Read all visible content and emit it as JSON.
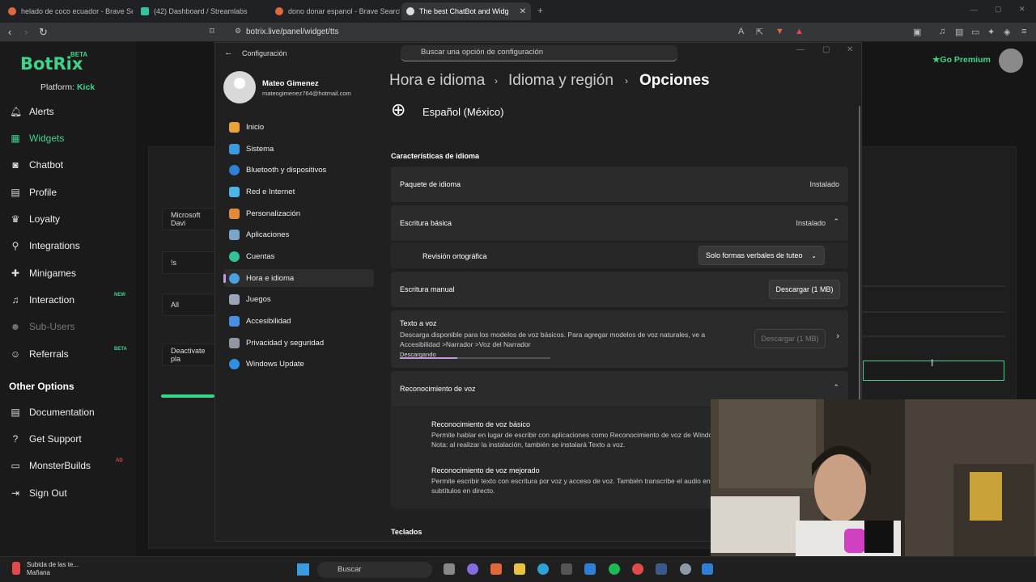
{
  "browser": {
    "tabs": [
      {
        "title": "helado de coco ecuador - Brave Search"
      },
      {
        "title": "(42) Dashboard / Streamlabs"
      },
      {
        "title": "dono donar espanol - Brave Search"
      },
      {
        "title": "The best ChatBot and Widgets fo"
      }
    ],
    "url": "botrix.live/panel/widget/tts"
  },
  "botrix": {
    "logo": "BotRix",
    "beta": "BETA",
    "platform_label": "Platform:",
    "platform_value": "Kick",
    "go_premium": "Go Premium",
    "menu": [
      {
        "label": "Alerts",
        "icon": "bell-icon"
      },
      {
        "label": "Widgets",
        "icon": "grid-icon"
      },
      {
        "label": "Chatbot",
        "icon": "robot-icon"
      },
      {
        "label": "Profile",
        "icon": "id-card-icon"
      },
      {
        "label": "Loyalty",
        "icon": "trophy-icon"
      },
      {
        "label": "Integrations",
        "icon": "plug-icon"
      },
      {
        "label": "Minigames",
        "icon": "gamepad-icon"
      },
      {
        "label": "Interaction",
        "icon": "music-icon",
        "badge": "NEW"
      },
      {
        "label": "Sub-Users",
        "icon": "users-icon"
      },
      {
        "label": "Referrals",
        "icon": "people-icon",
        "badge": "BETA"
      }
    ],
    "other_options": "Other Options",
    "other_menu": [
      {
        "label": "Documentation",
        "icon": "book-icon"
      },
      {
        "label": "Get Support",
        "icon": "help-icon"
      },
      {
        "label": "MonsterBuilds",
        "icon": "monitor-icon",
        "badge": "AD"
      },
      {
        "label": "Sign Out",
        "icon": "sign-out-icon"
      }
    ],
    "fields": {
      "voice": "Microsoft Davi",
      "prefix": "!s",
      "permission": "All",
      "mode": "Deactivate pla"
    }
  },
  "settings": {
    "title": "Configuración",
    "search_placeholder": "Buscar una opción de configuración",
    "user": {
      "name": "Mateo Gimenez",
      "email": "mateogimenez764@hotmail.com"
    },
    "nav": [
      {
        "label": "Inicio",
        "color": "#e8a33b"
      },
      {
        "label": "Sistema",
        "color": "#3a9be0"
      },
      {
        "label": "Bluetooth y dispositivos",
        "color": "#2f7fd6"
      },
      {
        "label": "Red e Internet",
        "color": "#4fb3e6"
      },
      {
        "label": "Personalización",
        "color": "#e08a3a"
      },
      {
        "label": "Aplicaciones",
        "color": "#7aa6c9"
      },
      {
        "label": "Cuentas",
        "color": "#34c19a"
      },
      {
        "label": "Hora e idioma",
        "color": "#4aa0e0"
      },
      {
        "label": "Juegos",
        "color": "#9aa6b5"
      },
      {
        "label": "Accesibilidad",
        "color": "#4a8fe0"
      },
      {
        "label": "Privacidad y seguridad",
        "color": "#8f98a3"
      },
      {
        "label": "Windows Update",
        "color": "#2f8fe0"
      }
    ],
    "active_nav": "Hora e idioma",
    "breadcrumb": [
      "Hora e idioma",
      "Idioma y región",
      "Opciones"
    ],
    "language": "Español (México)",
    "features_heading": "Características de idioma",
    "pack": {
      "label": "Paquete de idioma",
      "status": "Instalado"
    },
    "basic_typing": {
      "label": "Escritura básica",
      "status": "Instalado"
    },
    "spelling": {
      "label": "Revisión ortográfica",
      "value": "Solo formas verbales de tuteo"
    },
    "handwriting": {
      "label": "Escritura manual",
      "button": "Descargar (1 MB)"
    },
    "tts": {
      "label": "Texto a voz",
      "description": "Descarga disponible para los modelos de voz básicos. Para agregar modelos de voz naturales, ve a Accesibilidad >Narrador >Voz del Narrador",
      "status": "Descargando",
      "progress": 0.38,
      "button": "Descargar (1 MB)"
    },
    "speech": {
      "label": "Reconocimiento de voz",
      "basic_title": "Reconocimiento de voz básico",
      "basic_desc": "Permite hablar en lugar de escribir con aplicaciones como Reconocimiento de voz de Windows. Nota: al realizar la instalación, también se instalará Texto a voz.",
      "enhanced_title": "Reconocimiento de voz mejorado",
      "enhanced_desc": "Permite escribir texto con escritura por voz y acceso de voz. También transcribe el audio en subtítulos en directo."
    },
    "keyboards": "Teclados"
  },
  "taskbar": {
    "weather_title": "Subida de las te...",
    "weather_sub": "Mañana",
    "search": "Buscar"
  }
}
